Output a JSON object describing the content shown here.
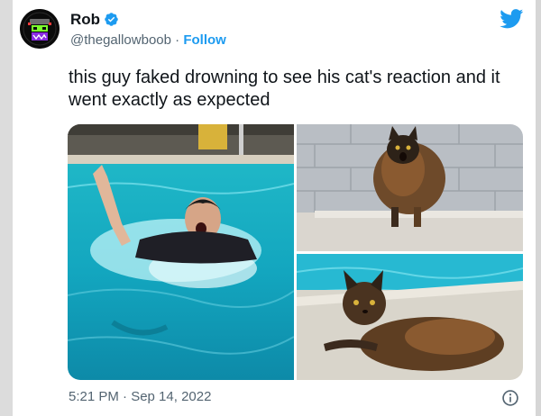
{
  "tweet": {
    "author_name": "Rob",
    "handle": "@thegallowboob",
    "separator": "·",
    "follow_label": "Follow",
    "text": "this guy faked drowning to see his cat's reaction and it went exactly as expected",
    "timestamp": "5:21 PM · Sep 14, 2022"
  },
  "icons": {
    "verified": "verified-badge-icon",
    "brand": "twitter-bird-icon",
    "info": "info-icon"
  },
  "colors": {
    "accent": "#1d9bf0",
    "text": "#0f1419",
    "muted": "#536471"
  },
  "media": {
    "count": 3
  }
}
